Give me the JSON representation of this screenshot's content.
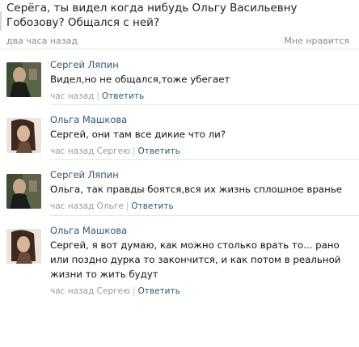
{
  "post": {
    "text": "Серёга, ты видел когда нибудь Ольгу Васильевну Гобозову? Общался с ней?",
    "time": "два часа назад",
    "like": "Мне нравится"
  },
  "comments": [
    {
      "author": "Сергей Ляпин",
      "text": "Видел,но не общался,тоже убегает",
      "time": "час назад",
      "to": "",
      "reply": "Ответить"
    },
    {
      "author": "Ольга Машкова",
      "text": "Сергей, они там все дикие что ли?",
      "time": "час назад",
      "to": "Сергею",
      "reply": "Ответить"
    },
    {
      "author": "Сергей Ляпин",
      "text": "Ольга, так правды боятся,вся их жизнь сплошное вранье",
      "time": "час назад",
      "to": "Ольге",
      "reply": "Ответить"
    },
    {
      "author": "Ольга Машкова",
      "text": "Сергей, я вот думаю, как можно столько врать то... рано или поздно дурка то закончится, и как потом в реальной жизни то жить будут",
      "time": "час назад",
      "to": "Сергею",
      "reply": "Ответить"
    }
  ],
  "colors": {
    "link": "#2b587a",
    "meta": "#999999",
    "text": "#111111"
  },
  "icons": {
    "sergey_avatar": "avatar-photo",
    "olga_avatar": "avatar-photo"
  }
}
